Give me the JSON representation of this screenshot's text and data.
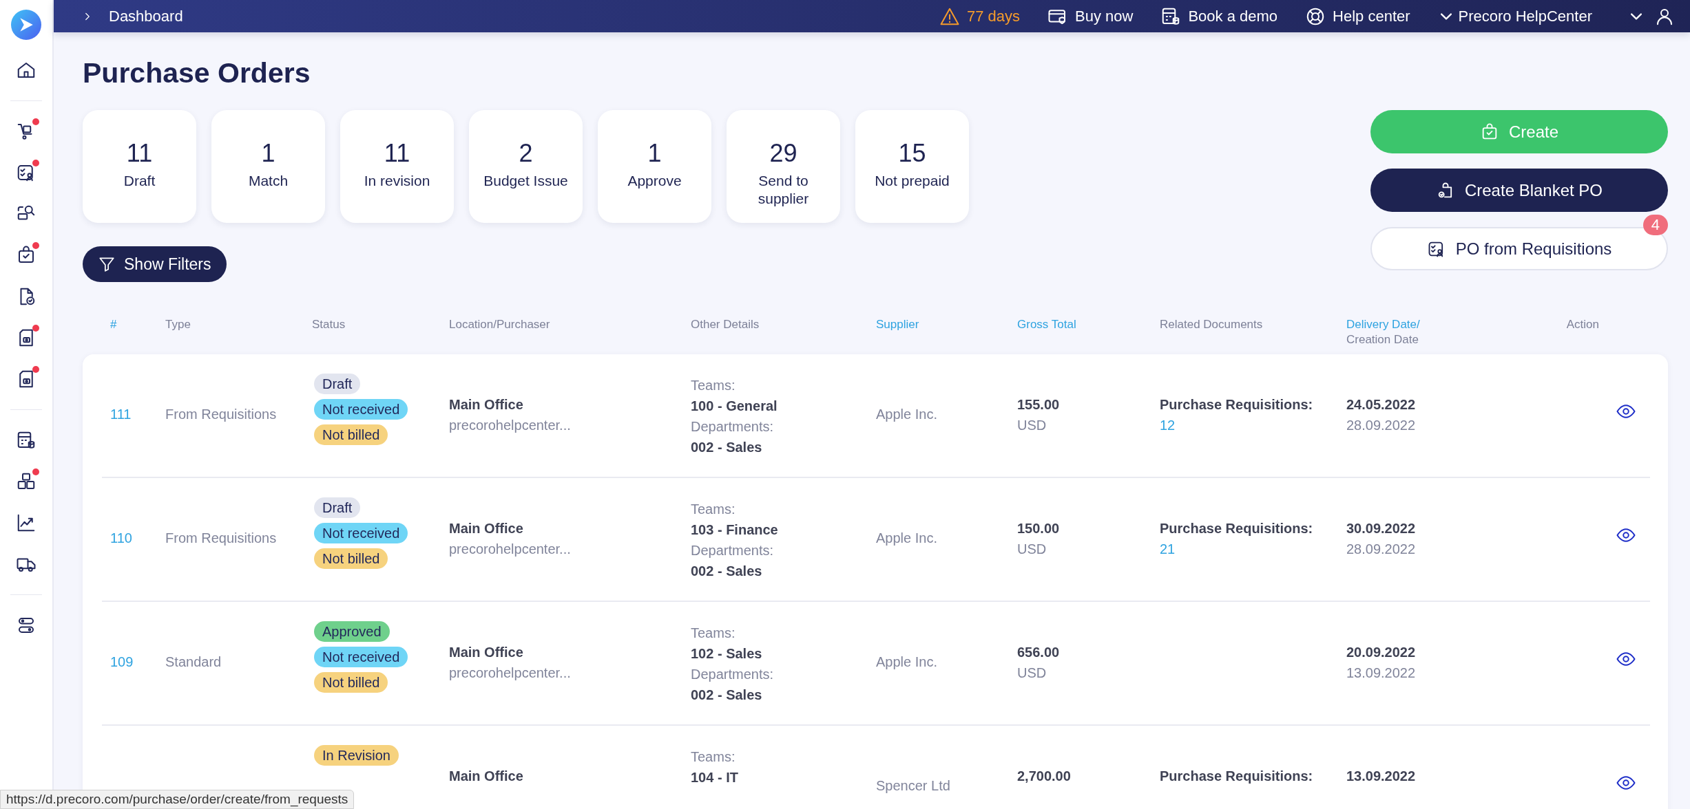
{
  "topbar": {
    "breadcrumb": "Dashboard",
    "trial": "77 days",
    "links": [
      "Buy now",
      "Book a demo",
      "Help center"
    ],
    "account": "Precoro HelpCenter"
  },
  "sidebar": {
    "groups": [
      [
        {
          "notification": false
        }
      ],
      [
        {
          "notification": true
        },
        {
          "notification": true
        },
        {
          "notification": false
        },
        {
          "notification": true
        },
        {
          "notification": false
        },
        {
          "notification": true
        },
        {
          "notification": true
        }
      ],
      [
        {
          "notification": false
        },
        {
          "notification": true
        },
        {
          "notification": false
        },
        {
          "notification": false
        }
      ],
      [
        {
          "notification": false
        }
      ]
    ]
  },
  "title": "Purchase Orders",
  "summary": [
    {
      "count": "11",
      "label": "Draft"
    },
    {
      "count": "1",
      "label": "Match"
    },
    {
      "count": "11",
      "label": "In revision"
    },
    {
      "count": "2",
      "label": "Budget Issue"
    },
    {
      "count": "1",
      "label": "Approve"
    },
    {
      "count": "29",
      "label": "Send to supplier"
    },
    {
      "count": "15",
      "label": "Not prepaid"
    }
  ],
  "filters_button": "Show Filters",
  "actions": [
    {
      "kind": "primary",
      "label": "Create"
    },
    {
      "kind": "dark",
      "label": "Create Blanket PO"
    },
    {
      "kind": "outline",
      "label": "PO from Requisitions",
      "badge": "4"
    }
  ],
  "table": {
    "columns": [
      {
        "label": "#",
        "sortable": true
      },
      {
        "label": "Type",
        "sortable": false
      },
      {
        "label": "Status",
        "sortable": false
      },
      {
        "label": "Location/Purchaser",
        "sortable": false
      },
      {
        "label": "Other Details",
        "sortable": false
      },
      {
        "label": "Supplier",
        "sortable": true
      },
      {
        "label": "Gross Total",
        "sortable": true
      },
      {
        "label": "Related Documents",
        "sortable": false
      },
      {
        "label": "Delivery Date/",
        "sublabel": "Creation Date",
        "sortable": true
      },
      {
        "label": "Action",
        "sortable": false
      }
    ],
    "rows": [
      {
        "id": "111",
        "type": "From Requisitions",
        "statuses": [
          {
            "label": "Draft",
            "color": "#e2e5ef"
          },
          {
            "label": "Not received",
            "color": "#6fd5f6"
          },
          {
            "label": "Not billed",
            "color": "#f6d27e"
          }
        ],
        "location": "Main Office",
        "purchaser": "precorohelpcenter...",
        "teams_label": "Teams:",
        "team": "100 - General",
        "departments_label": "Departments:",
        "department": "002 - Sales",
        "supplier": "Apple Inc.",
        "total": "155.00",
        "currency": "USD",
        "related_label": "Purchase Requisitions:",
        "related_link": "12",
        "delivery_date": "24.05.2022",
        "creation_date": "28.09.2022"
      },
      {
        "id": "110",
        "type": "From Requisitions",
        "statuses": [
          {
            "label": "Draft",
            "color": "#e2e5ef"
          },
          {
            "label": "Not received",
            "color": "#6fd5f6"
          },
          {
            "label": "Not billed",
            "color": "#f6d27e"
          }
        ],
        "location": "Main Office",
        "purchaser": "precorohelpcenter...",
        "teams_label": "Teams:",
        "team": "103 - Finance",
        "departments_label": "Departments:",
        "department": "002 - Sales",
        "supplier": "Apple Inc.",
        "total": "150.00",
        "currency": "USD",
        "related_label": "Purchase Requisitions:",
        "related_link": "21",
        "delivery_date": "30.09.2022",
        "creation_date": "28.09.2022"
      },
      {
        "id": "109",
        "type": "Standard",
        "statuses": [
          {
            "label": "Approved",
            "color": "#6fd08c"
          },
          {
            "label": "Not received",
            "color": "#6fd5f6"
          },
          {
            "label": "Not billed",
            "color": "#f6d27e"
          }
        ],
        "location": "Main Office",
        "purchaser": "precorohelpcenter...",
        "teams_label": "Teams:",
        "team": "102 - Sales",
        "departments_label": "Departments:",
        "department": "002 - Sales",
        "supplier": "Apple Inc.",
        "total": "656.00",
        "currency": "USD",
        "delivery_date": "20.09.2022",
        "creation_date": "13.09.2022"
      },
      {
        "statuses": [
          {
            "label": "In Revision",
            "color": "#f6d27e"
          }
        ],
        "location": "Main Office",
        "teams_label": "Teams:",
        "team": "104 - IT",
        "supplier": "Spencer Ltd",
        "total": "2,700.00",
        "related_label": "Purchase Requisitions:",
        "delivery_date": "13.09.2022"
      }
    ]
  },
  "status_url": "https://d.precoro.com/purchase/order/create/from_requests"
}
